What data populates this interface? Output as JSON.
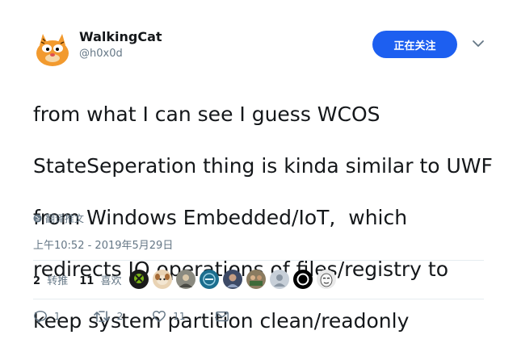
{
  "user": {
    "name": "WalkingCat",
    "handle": "@h0x0d"
  },
  "follow_button": {
    "label": "正在关注"
  },
  "tweet": {
    "lines": [
      "from what I can see I guess WCOS",
      "StateSeperation thing is kinda similar to UWF",
      "from Windows Embedded/IoT,  which",
      "redirects IO operations of files/registry to",
      "keep system partition clean/readonly"
    ],
    "translate_label": "翻译推文",
    "timestamp": "上午10:52 - 2019年5月29日"
  },
  "stats": {
    "retweets_count": "2",
    "retweets_label": "转推",
    "likes_count": "11",
    "likes_label": "喜欢"
  },
  "likers": [
    {
      "icon": "xbox-avatar-icon",
      "color": "#1a1a1a"
    },
    {
      "icon": "dog-avatar-icon",
      "color": "#d8b48a"
    },
    {
      "icon": "person-avatar-icon",
      "color": "#8a8a80"
    },
    {
      "icon": "teal-avatar-icon",
      "color": "#1b6e8e"
    },
    {
      "icon": "person-avatar-icon",
      "color": "#5b6a88"
    },
    {
      "icon": "group-avatar-icon",
      "color": "#8a7b60"
    },
    {
      "icon": "default-avatar-icon",
      "color": "#c7cfd8"
    },
    {
      "icon": "ring-avatar-icon",
      "color": "#000000"
    },
    {
      "icon": "mask-avatar-icon",
      "color": "#e9e9e9"
    }
  ],
  "actions": {
    "reply_count": "1",
    "retweet_count": "2",
    "like_count": "11"
  },
  "colors": {
    "accent": "#1d5ff0",
    "muted": "#657786",
    "divider": "#e6ecf0"
  }
}
